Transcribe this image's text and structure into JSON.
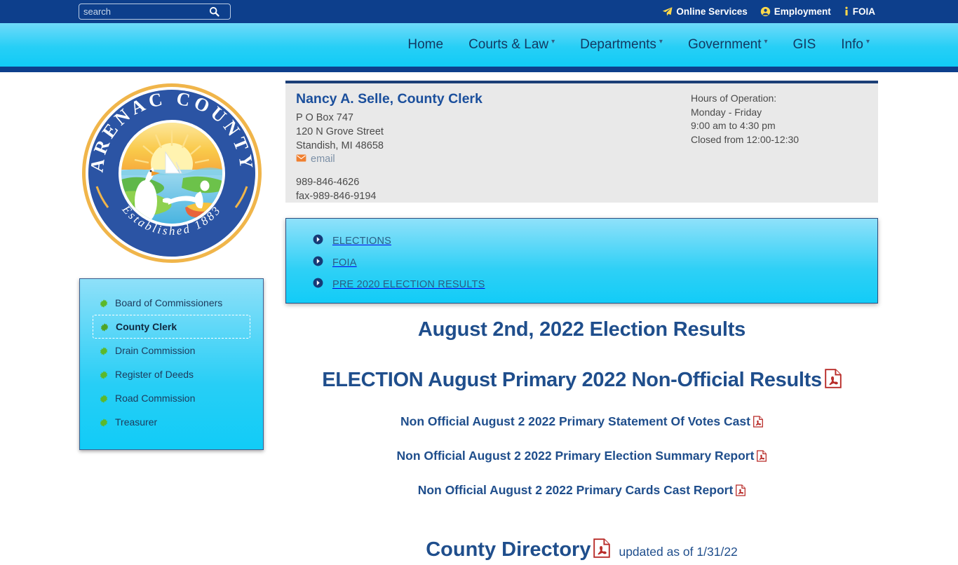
{
  "topbar": {
    "search": {
      "placeholder": "search",
      "value": "",
      "icon": "search-icon"
    },
    "links": [
      {
        "label": "Online Services",
        "icon": "paper-plane-icon"
      },
      {
        "label": "Employment",
        "icon": "user-circle-icon"
      },
      {
        "label": "FOIA",
        "icon": "info-icon"
      }
    ]
  },
  "nav": {
    "items": [
      {
        "label": "Home",
        "has_caret": false
      },
      {
        "label": "Courts & Law",
        "has_caret": true
      },
      {
        "label": "Departments",
        "has_caret": true
      },
      {
        "label": "Government",
        "has_caret": true
      },
      {
        "label": "GIS",
        "has_caret": false
      },
      {
        "label": "Info",
        "has_caret": true
      }
    ]
  },
  "seal": {
    "top_text": "ARENAC COUNTY",
    "bottom_text": "Established 1883",
    "alt": "arenac-county-seal"
  },
  "sidebar": {
    "items": [
      {
        "label": "Board of Commissioners",
        "active": false
      },
      {
        "label": "County Clerk",
        "active": true
      },
      {
        "label": "Drain Commission",
        "active": false
      },
      {
        "label": "Register of Deeds",
        "active": false
      },
      {
        "label": "Road Commission",
        "active": false
      },
      {
        "label": "Treasurer",
        "active": false
      }
    ],
    "bullet_color": "#5cb82b"
  },
  "contact": {
    "name": "Nancy A. Selle, County Clerk",
    "address_line1": "P O Box 747",
    "address_line2": "120 N Grove Street",
    "address_line3": "Standish, MI 48658",
    "email_label": "email",
    "email_icon": "envelope-icon",
    "phone": "989-846-4626",
    "fax": "fax-989-846-9194",
    "hours_title": "Hours of Operation:",
    "hours_days": "Monday - Friday",
    "hours_time": "9:00 am to 4:30 pm",
    "hours_closed": "Closed from 12:00-12:30"
  },
  "link_panel": {
    "items": [
      {
        "label": "ELECTIONS",
        "icon": "arrow-circle-right-icon"
      },
      {
        "label": "FOIA",
        "icon": "arrow-circle-right-icon"
      },
      {
        "label": "PRE 2020 ELECTION RESULTS",
        "icon": "arrow-circle-right-icon"
      }
    ]
  },
  "main": {
    "heading": "August 2nd, 2022 Election Results",
    "subheading": "ELECTION August Primary 2022 Non-Official Results",
    "documents": [
      {
        "label": "Non Official August 2 2022 Primary Statement Of Votes Cast",
        "icon": "pdf-icon"
      },
      {
        "label": "Non Official August 2 2022 Primary Election Summary Report",
        "icon": "pdf-icon"
      },
      {
        "label": "Non Official August 2 2022 Primary Cards Cast Report",
        "icon": "pdf-icon"
      }
    ],
    "directory": {
      "label": "County Directory",
      "icon": "pdf-icon",
      "updated": "updated as of 1/31/22"
    }
  },
  "colors": {
    "navy": "#0d3f8c",
    "cyan": "#18cdf5",
    "heading_blue": "#1f4e8c",
    "accent_yellow": "#ffd94a",
    "pdf_red": "#b82b28",
    "green_bullet": "#5cb82b",
    "email_orange": "#f08030"
  }
}
